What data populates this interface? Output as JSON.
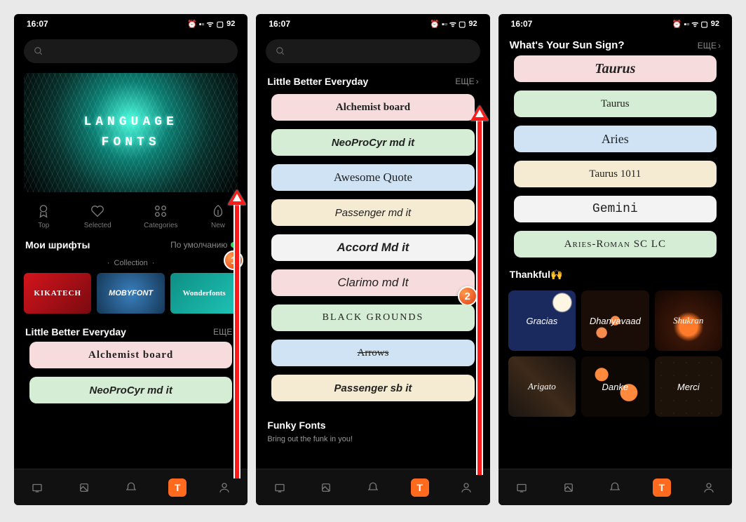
{
  "status": {
    "time": "16:07",
    "battery": "92"
  },
  "nav": {
    "top": "Top",
    "selected": "Selected",
    "categories": "Categories",
    "new": "New"
  },
  "more_label": "ЕЩЕ",
  "screen1": {
    "banner_l1": "LANGUAGE",
    "banner_l2": "FONTS",
    "my_fonts": "Мои шрифты",
    "default": "По умолчанию",
    "collection": "Collection",
    "cards": [
      "KIKATECH",
      "MOBYFONT",
      "Wonderfonts"
    ],
    "section": "Little Better Everyday",
    "fonts": [
      "Alchemist board",
      "NeoProCyr md it"
    ]
  },
  "screen2": {
    "section": "Little Better Everyday",
    "fonts": [
      "Alchemist board",
      "NeoProCyr md it",
      "Awesome Quote",
      "Passenger md it",
      "Accord Md it",
      "Clarimo md It",
      "BLACK GROUNDS",
      "Arrows",
      "Passenger sb it"
    ],
    "funky": "Funky Fonts",
    "funky_sub": "Bring out the funk in you!"
  },
  "screen3": {
    "section": "What's Your Sun Sign?",
    "fonts": [
      "Taurus",
      "Taurus",
      "Aries",
      "Taurus 1011",
      "Gemini",
      "Aries-Roman SC LC"
    ],
    "thankful": "Thankful🙌",
    "tiles": [
      "Gracias",
      "Dhanyavaad",
      "Shukran",
      "Arigato",
      "Danke",
      "Merci"
    ]
  }
}
